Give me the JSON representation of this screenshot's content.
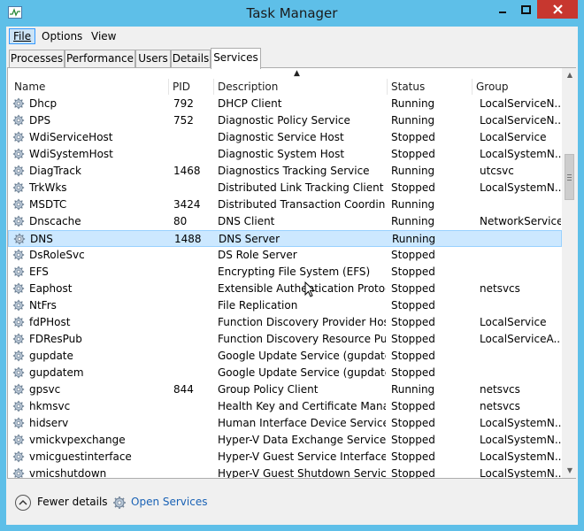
{
  "window": {
    "title": "Task Manager"
  },
  "menu": {
    "file": "File",
    "options": "Options",
    "view": "View"
  },
  "tabs": [
    {
      "label": "Processes"
    },
    {
      "label": "Performance"
    },
    {
      "label": "Users"
    },
    {
      "label": "Details"
    },
    {
      "label": "Services"
    }
  ],
  "columns": {
    "name": "Name",
    "pid": "PID",
    "description": "Description",
    "status": "Status",
    "group": "Group"
  },
  "rows": [
    {
      "name": "Dhcp",
      "pid": "792",
      "description": "DHCP Client",
      "status": "Running",
      "group": "LocalServiceN..."
    },
    {
      "name": "DPS",
      "pid": "752",
      "description": "Diagnostic Policy Service",
      "status": "Running",
      "group": "LocalServiceN..."
    },
    {
      "name": "WdiServiceHost",
      "pid": "",
      "description": "Diagnostic Service Host",
      "status": "Stopped",
      "group": "LocalService"
    },
    {
      "name": "WdiSystemHost",
      "pid": "",
      "description": "Diagnostic System Host",
      "status": "Stopped",
      "group": "LocalSystemN..."
    },
    {
      "name": "DiagTrack",
      "pid": "1468",
      "description": "Diagnostics Tracking Service",
      "status": "Running",
      "group": "utcsvc"
    },
    {
      "name": "TrkWks",
      "pid": "",
      "description": "Distributed Link Tracking Client",
      "status": "Stopped",
      "group": "LocalSystemN..."
    },
    {
      "name": "MSDTC",
      "pid": "3424",
      "description": "Distributed Transaction Coordin...",
      "status": "Running",
      "group": ""
    },
    {
      "name": "Dnscache",
      "pid": "80",
      "description": "DNS Client",
      "status": "Running",
      "group": "NetworkService"
    },
    {
      "name": "DNS",
      "pid": "1488",
      "description": "DNS Server",
      "status": "Running",
      "group": ""
    },
    {
      "name": "DsRoleSvc",
      "pid": "",
      "description": "DS Role Server",
      "status": "Stopped",
      "group": ""
    },
    {
      "name": "EFS",
      "pid": "",
      "description": "Encrypting File System (EFS)",
      "status": "Stopped",
      "group": ""
    },
    {
      "name": "Eaphost",
      "pid": "",
      "description": "Extensible Authentication Protocol",
      "status": "Stopped",
      "group": "netsvcs"
    },
    {
      "name": "NtFrs",
      "pid": "",
      "description": "File Replication",
      "status": "Stopped",
      "group": ""
    },
    {
      "name": "fdPHost",
      "pid": "",
      "description": "Function Discovery Provider Host",
      "status": "Stopped",
      "group": "LocalService"
    },
    {
      "name": "FDResPub",
      "pid": "",
      "description": "Function Discovery Resource Pu...",
      "status": "Stopped",
      "group": "LocalServiceA..."
    },
    {
      "name": "gupdate",
      "pid": "",
      "description": "Google Update Service (gupdate)",
      "status": "Stopped",
      "group": ""
    },
    {
      "name": "gupdatem",
      "pid": "",
      "description": "Google Update Service (gupdatem)",
      "status": "Stopped",
      "group": ""
    },
    {
      "name": "gpsvc",
      "pid": "844",
      "description": "Group Policy Client",
      "status": "Running",
      "group": "netsvcs"
    },
    {
      "name": "hkmsvc",
      "pid": "",
      "description": "Health Key and Certificate Mana...",
      "status": "Stopped",
      "group": "netsvcs"
    },
    {
      "name": "hidserv",
      "pid": "",
      "description": "Human Interface Device Service",
      "status": "Stopped",
      "group": "LocalSystemN..."
    },
    {
      "name": "vmickvpexchange",
      "pid": "",
      "description": "Hyper-V Data Exchange Service",
      "status": "Stopped",
      "group": "LocalSystemN..."
    },
    {
      "name": "vmicguestinterface",
      "pid": "",
      "description": "Hyper-V Guest Service Interface",
      "status": "Stopped",
      "group": "LocalSystemN..."
    },
    {
      "name": "vmicshutdown",
      "pid": "",
      "description": "Hyper-V Guest Shutdown Service",
      "status": "Stopped",
      "group": "LocalSystemN..."
    }
  ],
  "selected_row": "DNS",
  "footer": {
    "fewer_details": "Fewer details",
    "open_services": "Open Services"
  },
  "colors": {
    "title_bar": "#5ebfe8",
    "close_button": "#c7372f",
    "selection": "#cce8ff",
    "link": "#1a62b5"
  }
}
